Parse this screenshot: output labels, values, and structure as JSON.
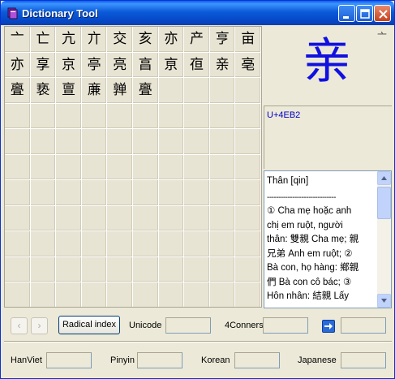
{
  "window": {
    "title": "Dictionary Tool",
    "icon": "book-icon",
    "controls": [
      "minimize-icon",
      "maximize-icon",
      "close-icon"
    ]
  },
  "grid": {
    "rows": [
      [
        "亠",
        "亡",
        "亢",
        "亣",
        "交",
        "亥",
        "亦",
        "产",
        "亨",
        "亩"
      ],
      [
        "亦",
        "享",
        "京",
        "亭",
        "亮",
        "亯",
        "亰",
        "亱",
        "亲",
        "亳"
      ],
      [
        "亹",
        "亵",
        "亶",
        "亷",
        "亸",
        "亹",
        "",
        "",
        "",
        ""
      ]
    ],
    "empty_rows": 8
  },
  "preview": {
    "character": "亲",
    "stroke_label": "亠"
  },
  "unicode_panel": {
    "code": "U+4EB2"
  },
  "meaning": {
    "heading": "Thân [qin]",
    "separator": "------------------------------",
    "lines": [
      "① Cha mẹ hoặc anh",
      "chị em ruột, người",
      "thân: 雙親 Cha mẹ; 親",
      "兄弟 Anh em ruột; ②",
      "Bà con, họ hàng: 鄉親",
      "們 Bà con cô bác; ③",
      "Hôn nhân: 結親 Lấy"
    ]
  },
  "toolbar": {
    "prev": "‹",
    "next": "›",
    "radical_label": "Radical index",
    "unicode_label": "Unicode",
    "unicode_value": "",
    "fourcorners_label": "4Conners",
    "fourcorners_value": "",
    "go_icon": "arrow-right-icon",
    "go_value": ""
  },
  "bottom": {
    "hanviet_label": "HanViet",
    "hanviet_value": "",
    "pinyin_label": "Pinyin",
    "pinyin_value": "",
    "korean_label": "Korean",
    "korean_value": "",
    "japanese_label": "Japanese",
    "japanese_value": ""
  }
}
